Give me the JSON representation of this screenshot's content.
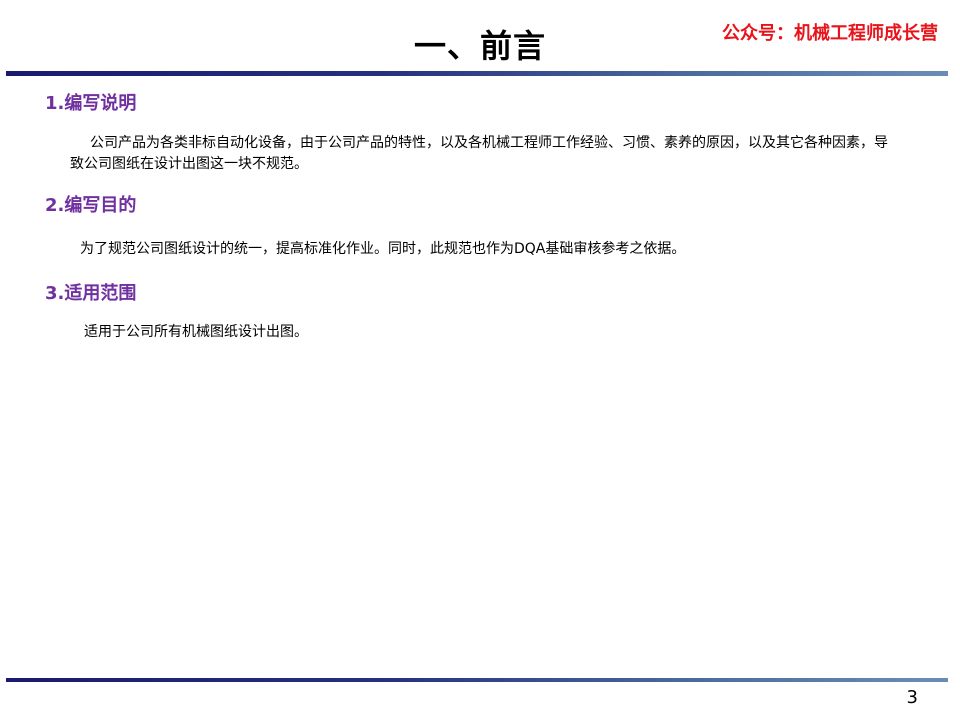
{
  "header": {
    "title": "一、前言",
    "watermark": "公众号：机械工程师成长营"
  },
  "sections": [
    {
      "heading": "1.编写说明",
      "text": "公司产品为各类非标自动化设备，由于公司产品的特性，以及各机械工程师工作经验、习惯、素养的原因，以及其它各种因素，导致公司图纸在设计出图这一块不规范。"
    },
    {
      "heading": "2.编写目的",
      "text": "为了规范公司图纸设计的统一，提高标准化作业。同时，此规范也作为DQA基础审核参考之依据。"
    },
    {
      "heading": "3.适用范围",
      "text": "适用于公司所有机械图纸设计出图。"
    }
  ],
  "footer": {
    "page_number": "3"
  },
  "colors": {
    "heading": "#7030a0",
    "watermark": "#e8141b",
    "rule": "#1a1a6e"
  }
}
